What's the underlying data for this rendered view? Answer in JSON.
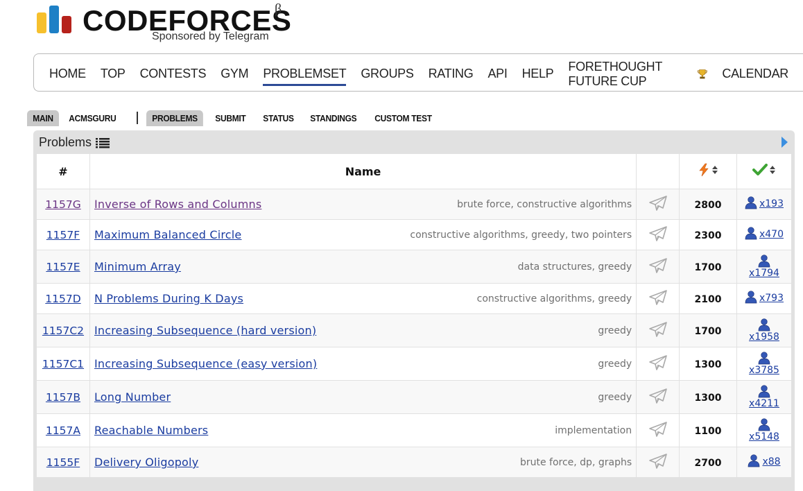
{
  "logo": {
    "text": "CODEFORCES",
    "beta": "β",
    "sponsor": "Sponsored by Telegram",
    "colors": {
      "yellow": "#f6c02d",
      "blue": "#1e80c6",
      "red": "#b6221b"
    }
  },
  "main_menu": {
    "items": [
      "HOME",
      "TOP",
      "CONTESTS",
      "GYM",
      "PROBLEMSET",
      "GROUPS",
      "RATING",
      "API",
      "HELP",
      "FORETHOUGHT FUTURE CUP",
      "CALENDAR"
    ],
    "active": "PROBLEMSET",
    "active_underline_color": "#2d4b96"
  },
  "second_menu": {
    "items": [
      "MAIN",
      "ACMSGURU",
      "PROBLEMS",
      "SUBMIT",
      "STATUS",
      "STANDINGS",
      "CUSTOM TEST"
    ],
    "selected": [
      "MAIN",
      "PROBLEMS"
    ]
  },
  "problems": {
    "title": "Problems",
    "headers": {
      "id": "#",
      "name": "Name"
    },
    "rows": [
      {
        "id": "1157G",
        "name": "Inverse of Rows and Columns",
        "tags": "brute force, constructive algorithms",
        "difficulty": "2800",
        "solved": "x193",
        "visited": true
      },
      {
        "id": "1157F",
        "name": "Maximum Balanced Circle",
        "tags": "constructive algorithms, greedy, two pointers",
        "difficulty": "2300",
        "solved": "x470",
        "visited": false
      },
      {
        "id": "1157E",
        "name": "Minimum Array",
        "tags": "data structures, greedy",
        "difficulty": "1700",
        "solved": "x1794",
        "visited": false
      },
      {
        "id": "1157D",
        "name": "N Problems During K Days",
        "tags": "constructive algorithms, greedy",
        "difficulty": "2100",
        "solved": "x793",
        "visited": false
      },
      {
        "id": "1157C2",
        "name": "Increasing Subsequence (hard version)",
        "tags": "greedy",
        "difficulty": "1700",
        "solved": "x1958",
        "visited": false
      },
      {
        "id": "1157C1",
        "name": "Increasing Subsequence (easy version)",
        "tags": "greedy",
        "difficulty": "1300",
        "solved": "x3785",
        "visited": false
      },
      {
        "id": "1157B",
        "name": "Long Number",
        "tags": "greedy",
        "difficulty": "1300",
        "solved": "x4211",
        "visited": false
      },
      {
        "id": "1157A",
        "name": "Reachable Numbers",
        "tags": "implementation",
        "difficulty": "1100",
        "solved": "x5148",
        "visited": false
      },
      {
        "id": "1155F",
        "name": "Delivery Oligopoly",
        "tags": "brute force, dp, graphs",
        "difficulty": "2700",
        "solved": "x88",
        "visited": false
      }
    ]
  }
}
